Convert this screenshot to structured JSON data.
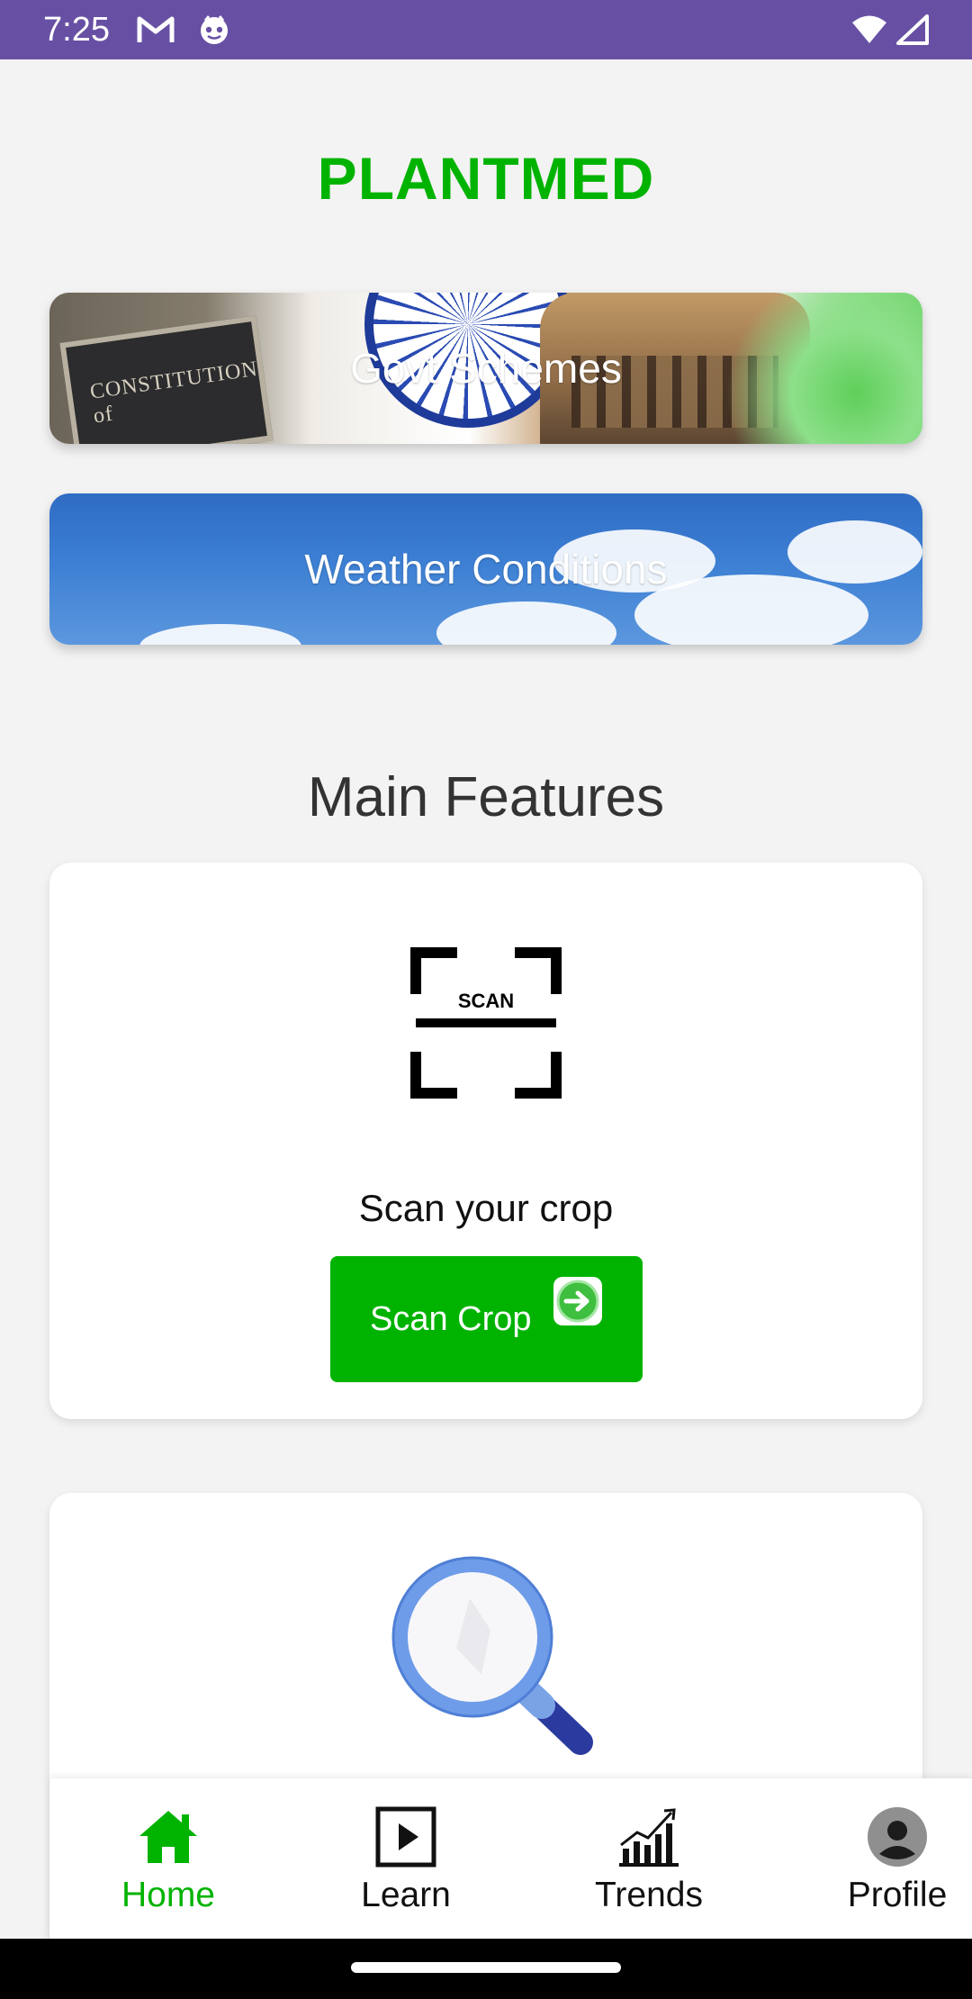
{
  "status_bar": {
    "time": "7:25",
    "icons_left": [
      "gmail-icon",
      "notification-bot-icon"
    ],
    "icons_right": [
      "wifi-icon",
      "cellular-signal-icon"
    ],
    "background_color": "#6750a4"
  },
  "app": {
    "title": "PLANTMED",
    "title_color": "#00b300"
  },
  "banners": [
    {
      "label": "Govt Schemes",
      "plaque_text": "CONSTITUTION of"
    },
    {
      "label": "Weather Conditions"
    }
  ],
  "section": {
    "heading": "Main Features"
  },
  "features": {
    "scan": {
      "icon": "scan-frame-icon",
      "icon_text": "SCAN",
      "description": "Scan your crop",
      "button_label": "Scan Crop",
      "button_icon": "arrow-right-circle-icon",
      "button_color": "#00b300"
    },
    "search": {
      "icon": "magnifier-icon"
    }
  },
  "bottom_nav": {
    "active_color": "#00b300",
    "items": [
      {
        "label": "Home",
        "icon": "home-icon",
        "active": true
      },
      {
        "label": "Learn",
        "icon": "play-icon",
        "active": false
      },
      {
        "label": "Trends",
        "icon": "trend-chart-icon",
        "active": false
      },
      {
        "label": "Profile",
        "icon": "profile-avatar-icon",
        "active": false
      }
    ]
  }
}
